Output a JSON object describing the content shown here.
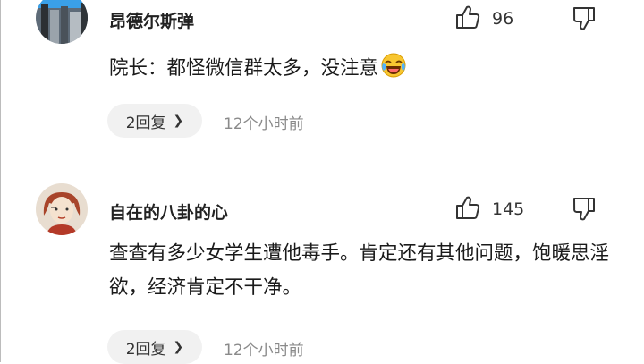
{
  "comments": [
    {
      "username": "昂德尔斯弹",
      "likes": "96",
      "text": "院长：都怪微信群太多，没注意",
      "reply_label": "2回复",
      "time": "12个小时前",
      "emoji": "tears-of-joy-emoji"
    },
    {
      "username": "自在的八卦的心",
      "likes": "145",
      "text": "查查有多少女学生遭他毒手。肯定还有其他问题，饱暖思淫欲，经济肯定不干净。",
      "reply_label": "2回复",
      "time": "12个小时前"
    }
  ],
  "icons": {
    "like": "thumbs-up-icon",
    "dislike": "thumbs-down-icon",
    "chevron": "chevron-right-icon"
  }
}
